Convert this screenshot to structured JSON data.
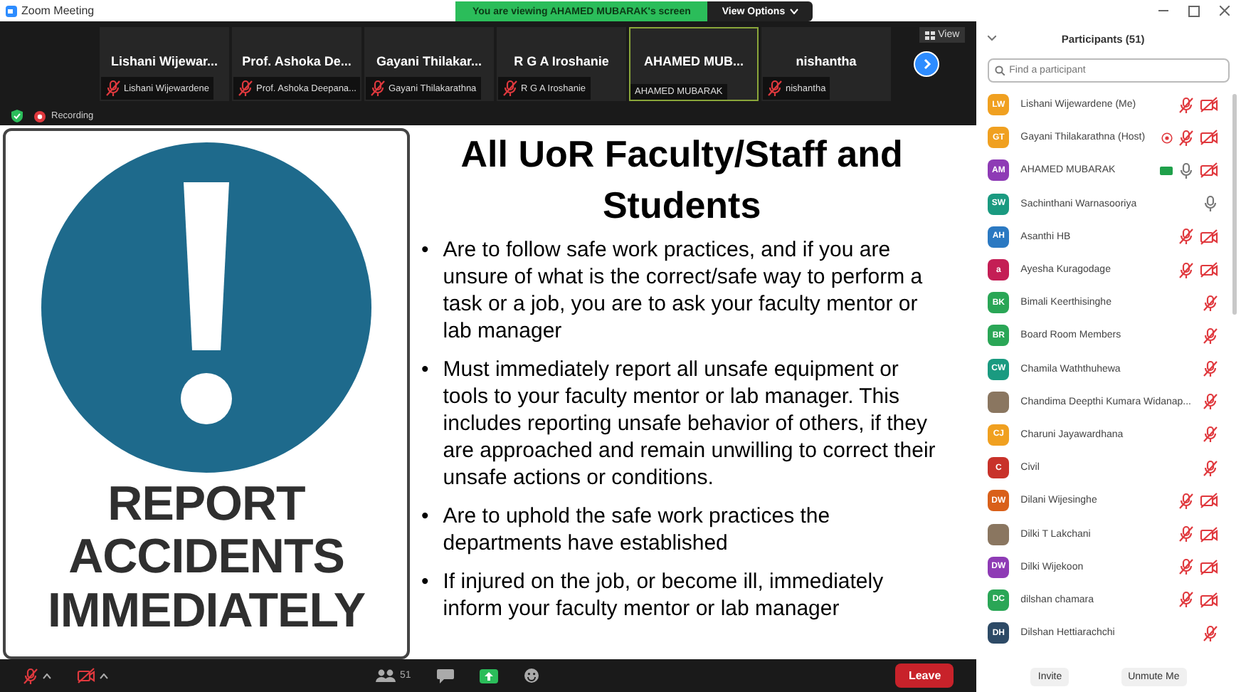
{
  "window": {
    "title": "Zoom Meeting"
  },
  "share_banner": {
    "text": "You are viewing AHAMED MUBARAK's screen",
    "options": "View Options"
  },
  "view_button": "View",
  "video_tiles": [
    {
      "display": "Lishani  Wijewar...",
      "label": "Lishani Wijewardene",
      "muted": true,
      "speaking": false
    },
    {
      "display": "Prof.  Ashoka  De...",
      "label": "Prof. Ashoka Deepana...",
      "muted": true,
      "speaking": false
    },
    {
      "display": "Gayani  Thilakar...",
      "label": "Gayani Thilakarathna",
      "muted": true,
      "speaking": false
    },
    {
      "display": "R G A Iroshanie",
      "label": "R G A Iroshanie",
      "muted": true,
      "speaking": false
    },
    {
      "display": "AHAMED  MUB...",
      "label": "AHAMED MUBARAK",
      "muted": false,
      "speaking": true
    },
    {
      "display": "nishantha",
      "label": "nishantha",
      "muted": true,
      "speaking": false
    }
  ],
  "recording": "Recording",
  "slide": {
    "sign": [
      "REPORT",
      "ACCIDENTS",
      "IMMEDIATELY"
    ],
    "title": "All UoR Faculty/Staff and Students",
    "bullets": [
      {
        "marker": "•",
        "text": "Are to follow safe work practices, and if you are unsure of what is the correct/safe way to perform a task or a job, you are to ask your faculty mentor or lab manager"
      },
      {
        "marker": "•",
        "text": "Must immediately report all unsafe equipment or tools to your faculty mentor or lab manager. This includes reporting unsafe behavior of others, if they are approached and remain unwilling to correct their unsafe actions or conditions."
      },
      {
        "marker": "•",
        "text": "Are to uphold the safe work practices the departments have established"
      },
      {
        "marker": "•",
        "text": "If injured on the job, or become ill, immediately inform your faculty mentor or lab manager"
      }
    ]
  },
  "toolbar": {
    "participant_count": "51",
    "leave": "Leave"
  },
  "participants": {
    "title": "Participants (51)",
    "search": {
      "placeholder": "Find a participant"
    },
    "items": [
      {
        "initials": "LW",
        "color": "#f0a020",
        "name": "Lishani Wijewardene (Me)",
        "muted": true,
        "video_off": true,
        "host": false,
        "sharing": false
      },
      {
        "initials": "GT",
        "color": "#f0a020",
        "name": "Gayani Thilakarathna (Host)",
        "muted": true,
        "video_off": true,
        "host": true,
        "sharing": false
      },
      {
        "initials": "AM",
        "color": "#8e3bb5",
        "name": "AHAMED MUBARAK",
        "muted": false,
        "video_off": true,
        "host": false,
        "sharing": true
      },
      {
        "initials": "SW",
        "color": "#1a9a80",
        "name": "Sachinthani Warnasooriya",
        "muted": false,
        "video_off": false,
        "host": false,
        "sharing": false
      },
      {
        "initials": "AH",
        "color": "#2b79c2",
        "name": "Asanthi HB",
        "muted": true,
        "video_off": true,
        "host": false,
        "sharing": false
      },
      {
        "initials": "a",
        "color": "#c41e55",
        "name": "Ayesha Kuragodage",
        "muted": true,
        "video_off": true,
        "host": false,
        "sharing": false
      },
      {
        "initials": "BK",
        "color": "#2aa656",
        "name": "Bimali Keerthisinghe",
        "muted": true,
        "video_off": false,
        "host": false,
        "sharing": false
      },
      {
        "initials": "BR",
        "color": "#2aa656",
        "name": "Board Room Members",
        "muted": true,
        "video_off": false,
        "host": false,
        "sharing": false
      },
      {
        "initials": "CW",
        "color": "#1a9a80",
        "name": "Chamila Waththuhewa",
        "muted": true,
        "video_off": false,
        "host": false,
        "sharing": false
      },
      {
        "kind": "photo",
        "name": "Chandima Deepthi Kumara Widanap...",
        "muted": true,
        "video_off": false,
        "host": false,
        "sharing": false
      },
      {
        "initials": "CJ",
        "color": "#f0a020",
        "name": "Charuni Jayawardhana",
        "muted": true,
        "video_off": false,
        "host": false,
        "sharing": false
      },
      {
        "initials": "C",
        "color": "#c8322a",
        "name": "Civil",
        "muted": true,
        "video_off": false,
        "host": false,
        "sharing": false
      },
      {
        "initials": "DW",
        "color": "#d9601a",
        "name": "Dilani Wijesinghe",
        "muted": true,
        "video_off": true,
        "host": false,
        "sharing": false
      },
      {
        "kind": "photo",
        "name": "Dilki T  Lakchani",
        "muted": true,
        "video_off": true,
        "host": false,
        "sharing": false
      },
      {
        "initials": "DW",
        "color": "#8e3bb5",
        "name": "Dilki Wijekoon",
        "muted": true,
        "video_off": true,
        "host": false,
        "sharing": false
      },
      {
        "initials": "DC",
        "color": "#2aa656",
        "name": "dilshan chamara",
        "muted": true,
        "video_off": true,
        "host": false,
        "sharing": false
      },
      {
        "initials": "DH",
        "color": "#2d4a66",
        "name": "Dilshan Hettiarachchi",
        "muted": true,
        "video_off": false,
        "host": false,
        "sharing": false
      }
    ],
    "buttons": [
      "Invite",
      "Unmute Me"
    ]
  }
}
